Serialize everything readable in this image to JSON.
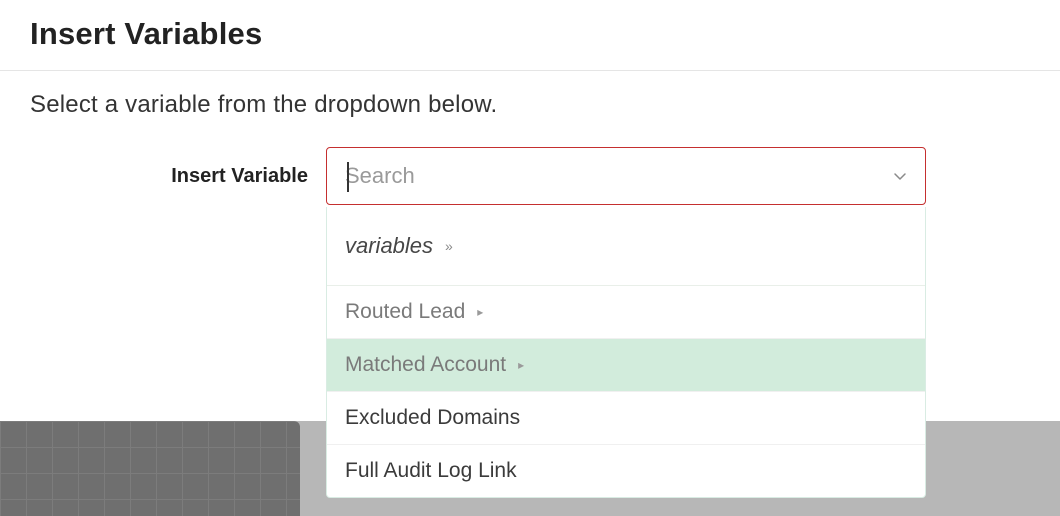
{
  "modal": {
    "title": "Insert Variables",
    "subtitle": "Select a variable from the dropdown below.",
    "field_label": "Insert Variable"
  },
  "search": {
    "placeholder": "Search",
    "value": ""
  },
  "breadcrumb": {
    "label": "variables"
  },
  "options": [
    {
      "label": "Routed Lead",
      "has_children": true,
      "muted": true,
      "hover": false
    },
    {
      "label": "Matched Account",
      "has_children": true,
      "muted": true,
      "hover": true
    },
    {
      "label": "Excluded Domains",
      "has_children": false,
      "muted": false,
      "hover": false
    },
    {
      "label": "Full Audit Log Link",
      "has_children": false,
      "muted": false,
      "hover": false
    }
  ]
}
